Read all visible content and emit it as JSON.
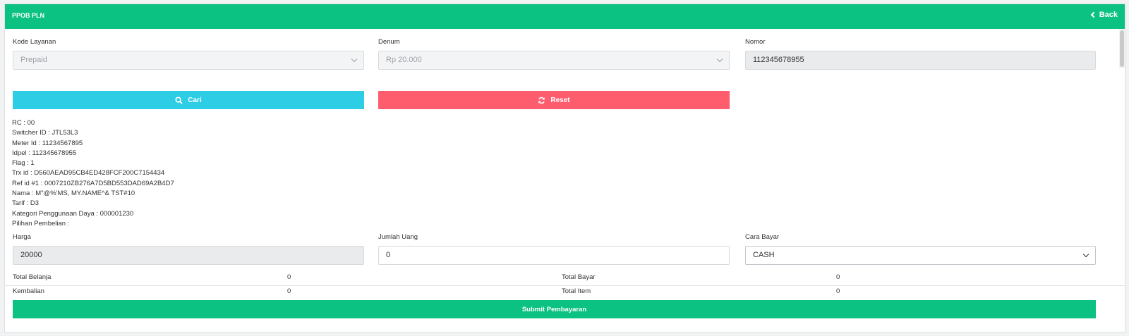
{
  "header": {
    "title": "PPOB PLN",
    "back_label": "Back"
  },
  "form": {
    "kode_layanan": {
      "label": "Kode Layanan",
      "value": "Prepaid"
    },
    "denum": {
      "label": "Denum",
      "value": "Rp 20.000"
    },
    "nomor": {
      "label": "Nomor",
      "value": "112345678955"
    }
  },
  "buttons": {
    "cari": "Cari",
    "reset": "Reset",
    "submit": "Submit Pembayaran"
  },
  "info_lines": [
    "RC : 00",
    "Switcher ID : JTL53L3",
    "Meter Id : 11234567895",
    "Idpel : 112345678955",
    "Flag : 1",
    "Trx id : D560AEAD95CB4ED428FCF200C7154434",
    "Ref id #1 : 0007210ZB276A7D5BD553DAD69A2B4D7",
    "Nama : M\"@%'MS, MY.NAME^& TST#10",
    "Tarif : D3",
    "Kategori Penggunaan Daya : 000001230",
    "Pilihan Pembelian :"
  ],
  "payment": {
    "harga": {
      "label": "Harga",
      "value": "20000"
    },
    "jumlah_uang": {
      "label": "Jumlah Uang",
      "value": "0"
    },
    "cara_bayar": {
      "label": "Cara Bayar",
      "value": "CASH"
    }
  },
  "summary": {
    "total_belanja": {
      "label": "Total Belanja",
      "value": "0"
    },
    "total_bayar": {
      "label": "Total Bayar",
      "value": "0"
    },
    "kembalian": {
      "label": "Kembalian",
      "value": "0"
    },
    "total_item": {
      "label": "Total Item",
      "value": "0"
    }
  },
  "colors": {
    "green": "#0bc282",
    "cyan": "#2dcde6",
    "red": "#fe5d6e"
  },
  "icons": {
    "back": "chevron-left-icon",
    "search": "search-icon",
    "reset": "refresh-icon",
    "select": "chevron-down-icon"
  }
}
